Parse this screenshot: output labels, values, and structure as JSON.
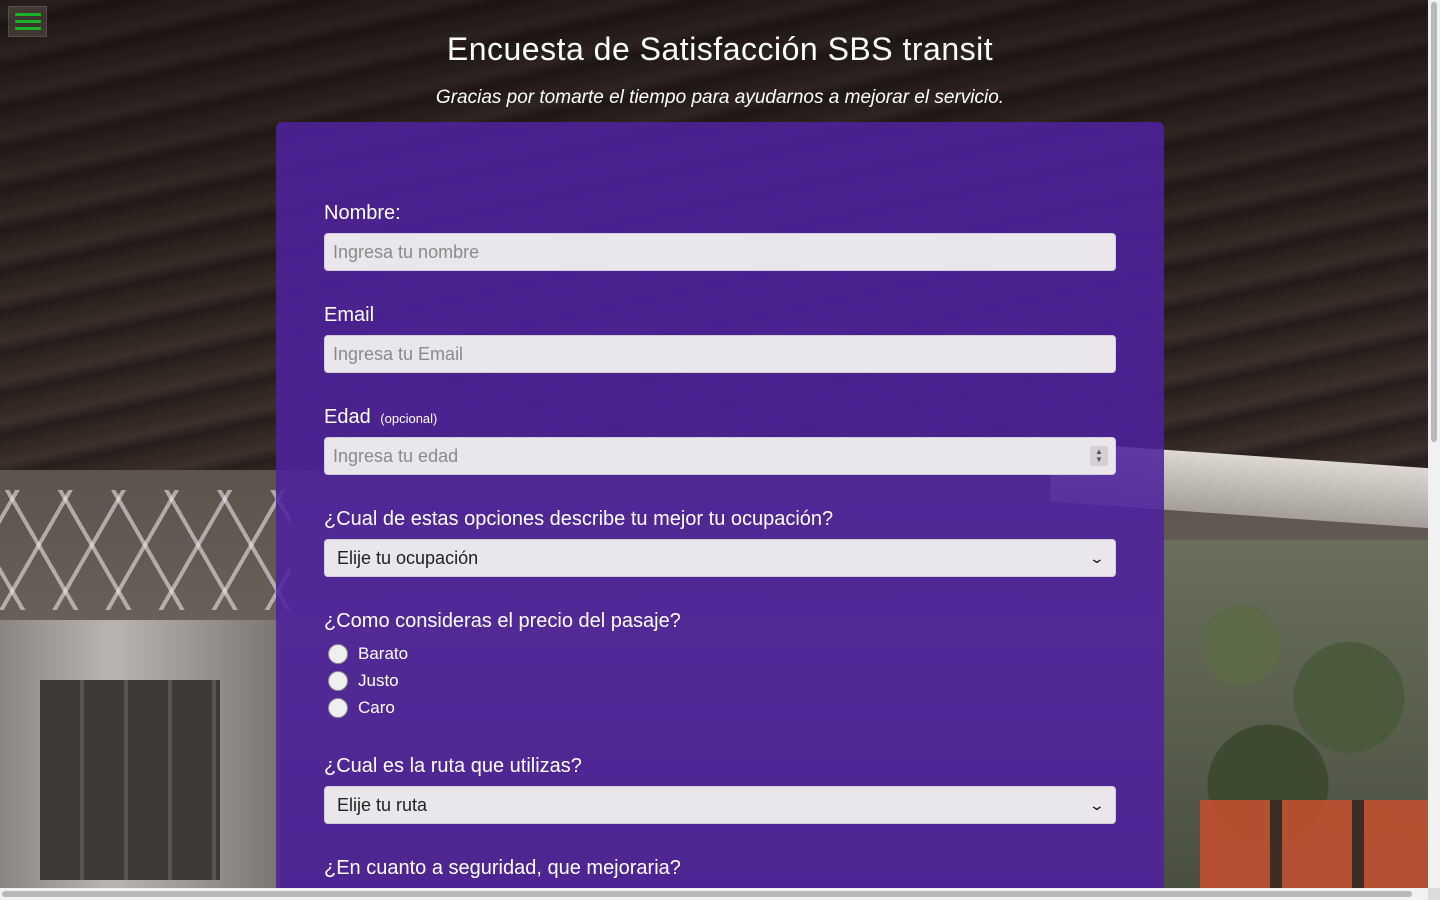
{
  "header": {
    "title": "Encuesta de Satisfacción SBS transit",
    "subtitle": "Gracias por tomarte el tiempo para ayudarnos a mejorar el servicio."
  },
  "menu": {
    "icon": "hamburger-icon",
    "color": "#1cb12b"
  },
  "form": {
    "name": {
      "label": "Nombre:",
      "placeholder": "Ingresa tu nombre"
    },
    "email": {
      "label": "Email",
      "placeholder": "Ingresa tu Email"
    },
    "age": {
      "label": "Edad",
      "note": "(opcional)",
      "placeholder": "Ingresa tu edad"
    },
    "occupation": {
      "label": "¿Cual de estas opciones describe tu mejor tu ocupación?",
      "selected": "Elije tu ocupación"
    },
    "price": {
      "label": "¿Como consideras el precio del pasaje?",
      "options": [
        "Barato",
        "Justo",
        "Caro"
      ]
    },
    "route": {
      "label": "¿Cual es la ruta que utilizas?",
      "selected": "Elije tu ruta"
    },
    "security": {
      "label": "¿En cuanto a seguridad, que mejoraria?"
    }
  },
  "colors": {
    "card": "#4d229e",
    "field": "#e9e6ec"
  }
}
